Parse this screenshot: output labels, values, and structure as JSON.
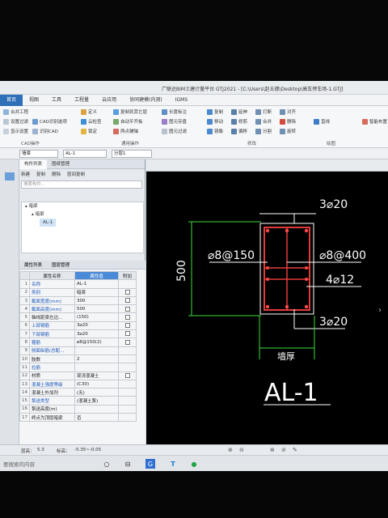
{
  "window": {
    "title": "广联达BIM土建计量平台 GTJ2021 - [C:\\Users\\赵五德\\Desktop\\高车停车场-1.GTJ]"
  },
  "menu": {
    "tabs": [
      "首页",
      "视图",
      "工具",
      "工程量",
      "云应用",
      "协同建模(内测)",
      "IGMS"
    ]
  },
  "ribbon": {
    "left_items": [
      "合并工程",
      "设置过滤",
      "显示设置",
      "CAD识别选项",
      "识别CAD"
    ],
    "cad_group_label": "CAD操作",
    "common_items": [
      "定义",
      "云检查",
      "锁定",
      "复制到其它层",
      "自动平齐板",
      "两点辅轴",
      "长度标注",
      "图元存盘",
      "图元过滤"
    ],
    "common_group_label": "通用操作",
    "modify_items": [
      "复制",
      "移动",
      "镜像",
      "延伸",
      "修剪",
      "偏移",
      "打断",
      "合并",
      "分割",
      "对齐",
      "删除",
      "旋转"
    ],
    "modify_group_label": "修改",
    "draw_items": [
      "直线"
    ],
    "draw_group_label": "绘图",
    "smart_label": "智能布置"
  },
  "selectors": {
    "floor": "墙梁",
    "element": "AL-1",
    "layer": "分层1"
  },
  "component_list": {
    "tabs": [
      "构件列表",
      "图纸管理"
    ],
    "toolbar": [
      "新建",
      "复制",
      "删除",
      "层间复制"
    ],
    "search_placeholder": "搜索构件...",
    "tree": {
      "root": "暗梁",
      "child": "暗梁",
      "leaf": "AL-1"
    }
  },
  "properties": {
    "tabs": [
      "属性列表",
      "图层管理"
    ],
    "headers": [
      "属性名称",
      "属性值",
      "附加"
    ],
    "rows": [
      {
        "num": "1",
        "name": "名称",
        "value": "AL-1",
        "blue": true,
        "check": false
      },
      {
        "num": "2",
        "name": "类别",
        "value": "暗梁",
        "blue": true,
        "check": true
      },
      {
        "num": "3",
        "name": "截面宽度(mm)",
        "value": "300",
        "blue": true,
        "check": true
      },
      {
        "num": "4",
        "name": "截面高度(mm)",
        "value": "500",
        "blue": true,
        "check": true
      },
      {
        "num": "5",
        "name": "轴线距梁左边...",
        "value": "(150)",
        "blue": false,
        "check": true
      },
      {
        "num": "6",
        "name": "上部钢筋",
        "value": "3⌀20",
        "blue": true,
        "check": true
      },
      {
        "num": "7",
        "name": "下部钢筋",
        "value": "3⌀20",
        "blue": true,
        "check": true
      },
      {
        "num": "8",
        "name": "箍筋",
        "value": "⌀8@150(2)",
        "blue": true,
        "check": true
      },
      {
        "num": "9",
        "name": "侧面纵筋(总配...",
        "value": "",
        "blue": true,
        "check": false
      },
      {
        "num": "10",
        "name": "肢数",
        "value": "2",
        "blue": false,
        "check": false
      },
      {
        "num": "11",
        "name": "拉筋",
        "value": "",
        "blue": true,
        "check": false
      },
      {
        "num": "12",
        "name": "材质",
        "value": "现浇混凝土",
        "blue": false,
        "check": true
      },
      {
        "num": "13",
        "name": "混凝土强度等级",
        "value": "(C30)",
        "blue": true,
        "check": false
      },
      {
        "num": "14",
        "name": "混凝土外加剂",
        "value": "(无)",
        "blue": false,
        "check": false
      },
      {
        "num": "15",
        "name": "泵送类型",
        "value": "(混凝土泵)",
        "blue": true,
        "check": false
      },
      {
        "num": "16",
        "name": "泵送高度(m)",
        "value": "",
        "blue": false,
        "check": false
      },
      {
        "num": "17",
        "name": "终点为顶层暗梁",
        "value": "否",
        "blue": false,
        "check": false
      }
    ]
  },
  "drawing": {
    "top_bar": "3⌀20",
    "stirrup": "⌀8@150",
    "stirrup2": "⌀8@400",
    "side_bar": "4⌀12",
    "bottom_bar": "3⌀20",
    "height": "500",
    "wall_label": "墙厚",
    "name": "AL-1"
  },
  "status": {
    "floor_height_label": "层高：",
    "floor_height": "5.3",
    "elevation_label": "标高：",
    "elevation": "-5.35~-0.05"
  },
  "taskbar": {
    "search_placeholder": "要搜索的内容"
  }
}
